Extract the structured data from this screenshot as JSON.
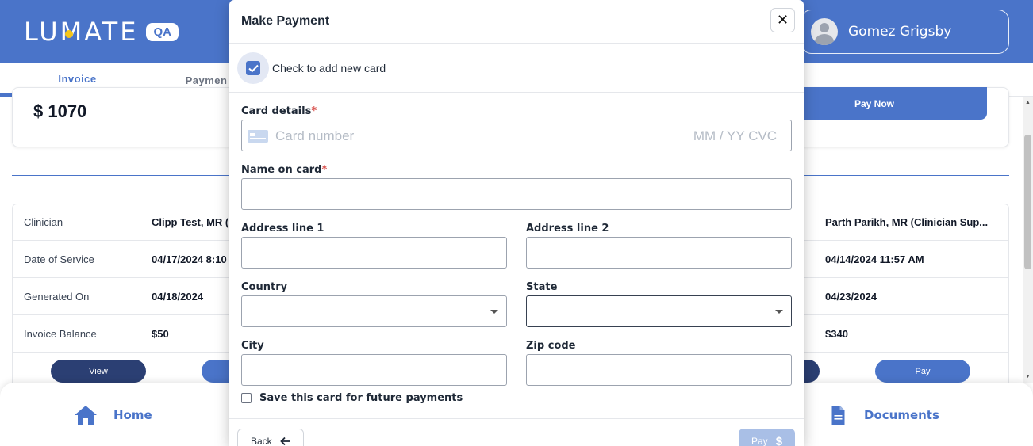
{
  "header": {
    "logo_text": "LUMATE",
    "env_badge": "QA",
    "user_name": "Gomez Grigsby"
  },
  "tabs": [
    {
      "label": "Invoice"
    },
    {
      "label": "Paymen"
    }
  ],
  "summary": {
    "amount": "$ 1070",
    "pay_now_label": "Pay Now"
  },
  "invoice_table": {
    "rows": [
      {
        "label": "Clinician",
        "col1": "Clipp Test, MR (",
        "col2": "Parth Parikh, MR (Clinician Sup..."
      },
      {
        "label": "Date of Service",
        "col1": "04/17/2024 8:10",
        "col2": "04/14/2024 11:57 AM"
      },
      {
        "label": "Generated On",
        "col1": "04/18/2024",
        "col2": "04/23/2024"
      },
      {
        "label": "Invoice Balance",
        "col1": "$50",
        "col2": "$340"
      }
    ],
    "view_label": "View",
    "pay_label": "Pay"
  },
  "bottom_nav": {
    "home_label": "Home",
    "documents_label": "Documents"
  },
  "modal": {
    "title": "Make Payment",
    "close_symbol": "✕",
    "add_card_label": "Check to add new card",
    "add_card_checked": true,
    "card_details_label": "Card details",
    "card_number_placeholder": "Card number",
    "card_expiry_cvc_placeholder": "MM / YY  CVC",
    "name_on_card_label": "Name on card",
    "address1_label": "Address line 1",
    "address2_label": "Address line 2",
    "country_label": "Country",
    "state_label": "State",
    "city_label": "City",
    "zip_label": "Zip code",
    "save_card_label": "Save this card for future payments",
    "back_label": "Back",
    "pay_label": "Pay",
    "pay_symbol": "$",
    "required_mark": "*"
  },
  "colors": {
    "primary": "#4a74c9",
    "dark_navy": "#2b3f73",
    "pay_disabled": "#a9bfe6",
    "required": "#d9534f"
  }
}
